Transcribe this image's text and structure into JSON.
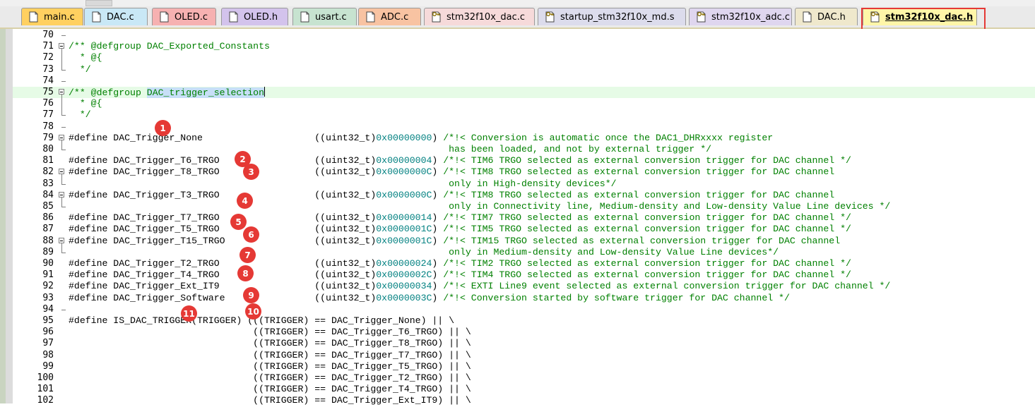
{
  "tabs": [
    {
      "label": "main.c",
      "color": "#ffd060",
      "icon": "file-icon",
      "active": false
    },
    {
      "label": "DAC.c",
      "color": "#c9e8f6",
      "icon": "file-icon",
      "active": false
    },
    {
      "label": "OLED.c",
      "color": "#f6b1b1",
      "icon": "file-icon",
      "active": false
    },
    {
      "label": "OLED.h",
      "color": "#d3c3ec",
      "icon": "file-icon",
      "active": false
    },
    {
      "label": "usart.c",
      "color": "#c7e3d0",
      "icon": "file-icon",
      "active": false
    },
    {
      "label": "ADC.c",
      "color": "#f8c3a2",
      "icon": "file-icon",
      "active": false
    },
    {
      "label": "stm32f10x_dac.c",
      "color": "#f6dada",
      "icon": "key-file-icon",
      "active": false
    },
    {
      "label": "startup_stm32f10x_md.s",
      "color": "#dcdcec",
      "icon": "key-file-icon",
      "active": false
    },
    {
      "label": "stm32f10x_adc.c",
      "color": "#dfd6ef",
      "icon": "key-file-icon",
      "active": false
    },
    {
      "label": "DAC.h",
      "color": "#efe8cc",
      "icon": "file-icon",
      "active": false
    },
    {
      "label": "stm32f10x_dac.h",
      "color": "#fff6a8",
      "icon": "key-file-icon",
      "active": true
    }
  ],
  "lines": [
    {
      "n": "70",
      "t": ""
    },
    {
      "n": "71",
      "t": "/** @defgroup DAC_Exported_Constants"
    },
    {
      "n": "72",
      "t": "  * @{"
    },
    {
      "n": "73",
      "t": "  */"
    },
    {
      "n": "74",
      "t": ""
    },
    {
      "n": "75",
      "t": "/** @defgroup DAC_trigger_selection"
    },
    {
      "n": "76",
      "t": "  * @{"
    },
    {
      "n": "77",
      "t": "  */"
    },
    {
      "n": "78",
      "t": ""
    },
    {
      "n": "79",
      "t": "#define DAC_Trigger_None                    ((uint32_t)0x00000000) /*!< Conversion is automatic once the DAC1_DHRxxxx register"
    },
    {
      "n": "80",
      "t": "                                                                    has been loaded, and not by external trigger */"
    },
    {
      "n": "81",
      "t": "#define DAC_Trigger_T6_TRGO                 ((uint32_t)0x00000004) /*!< TIM6 TRGO selected as external conversion trigger for DAC channel */"
    },
    {
      "n": "82",
      "t": "#define DAC_Trigger_T8_TRGO                 ((uint32_t)0x0000000C) /*!< TIM8 TRGO selected as external conversion trigger for DAC channel"
    },
    {
      "n": "83",
      "t": "                                                                    only in High-density devices*/"
    },
    {
      "n": "84",
      "t": "#define DAC_Trigger_T3_TRGO                 ((uint32_t)0x0000000C) /*!< TIM8 TRGO selected as external conversion trigger for DAC channel"
    },
    {
      "n": "85",
      "t": "                                                                    only in Connectivity line, Medium-density and Low-density Value Line devices */"
    },
    {
      "n": "86",
      "t": "#define DAC_Trigger_T7_TRGO                 ((uint32_t)0x00000014) /*!< TIM7 TRGO selected as external conversion trigger for DAC channel */"
    },
    {
      "n": "87",
      "t": "#define DAC_Trigger_T5_TRGO                 ((uint32_t)0x0000001C) /*!< TIM5 TRGO selected as external conversion trigger for DAC channel */"
    },
    {
      "n": "88",
      "t": "#define DAC_Trigger_T15_TRGO                ((uint32_t)0x0000001C) /*!< TIM15 TRGO selected as external conversion trigger for DAC channel"
    },
    {
      "n": "89",
      "t": "                                                                    only in Medium-density and Low-density Value Line devices*/"
    },
    {
      "n": "90",
      "t": "#define DAC_Trigger_T2_TRGO                 ((uint32_t)0x00000024) /*!< TIM2 TRGO selected as external conversion trigger for DAC channel */"
    },
    {
      "n": "91",
      "t": "#define DAC_Trigger_T4_TRGO                 ((uint32_t)0x0000002C) /*!< TIM4 TRGO selected as external conversion trigger for DAC channel */"
    },
    {
      "n": "92",
      "t": "#define DAC_Trigger_Ext_IT9                 ((uint32_t)0x00000034) /*!< EXTI Line9 event selected as external conversion trigger for DAC channel */"
    },
    {
      "n": "93",
      "t": "#define DAC_Trigger_Software                ((uint32_t)0x0000003C) /*!< Conversion started by software trigger for DAC channel */"
    },
    {
      "n": "94",
      "t": ""
    },
    {
      "n": "95",
      "t": "#define IS_DAC_TRIGGER(TRIGGER) (((TRIGGER) == DAC_Trigger_None) || \\"
    },
    {
      "n": "96",
      "t": "                                 ((TRIGGER) == DAC_Trigger_T6_TRGO) || \\"
    },
    {
      "n": "97",
      "t": "                                 ((TRIGGER) == DAC_Trigger_T8_TRGO) || \\"
    },
    {
      "n": "98",
      "t": "                                 ((TRIGGER) == DAC_Trigger_T7_TRGO) || \\"
    },
    {
      "n": "99",
      "t": "                                 ((TRIGGER) == DAC_Trigger_T5_TRGO) || \\"
    },
    {
      "n": "100",
      "t": "                                 ((TRIGGER) == DAC_Trigger_T2_TRGO) || \\"
    },
    {
      "n": "101",
      "t": "                                 ((TRIGGER) == DAC_Trigger_T4_TRGO) || \\"
    },
    {
      "n": "102",
      "t": "                                 ((TRIGGER) == DAC_Trigger_Ext_IT9) || \\"
    }
  ],
  "selection": "DAC_trigger_selection",
  "markers": [
    "1",
    "2",
    "3",
    "4",
    "5",
    "6",
    "7",
    "8",
    "9",
    "10",
    "11"
  ],
  "colors": {
    "comment": "#008000",
    "number": "#008080",
    "highlight_border": "#e53935",
    "marker": "#e53935",
    "current_line": "#e6fbe6",
    "selection": "#c7dff7"
  }
}
